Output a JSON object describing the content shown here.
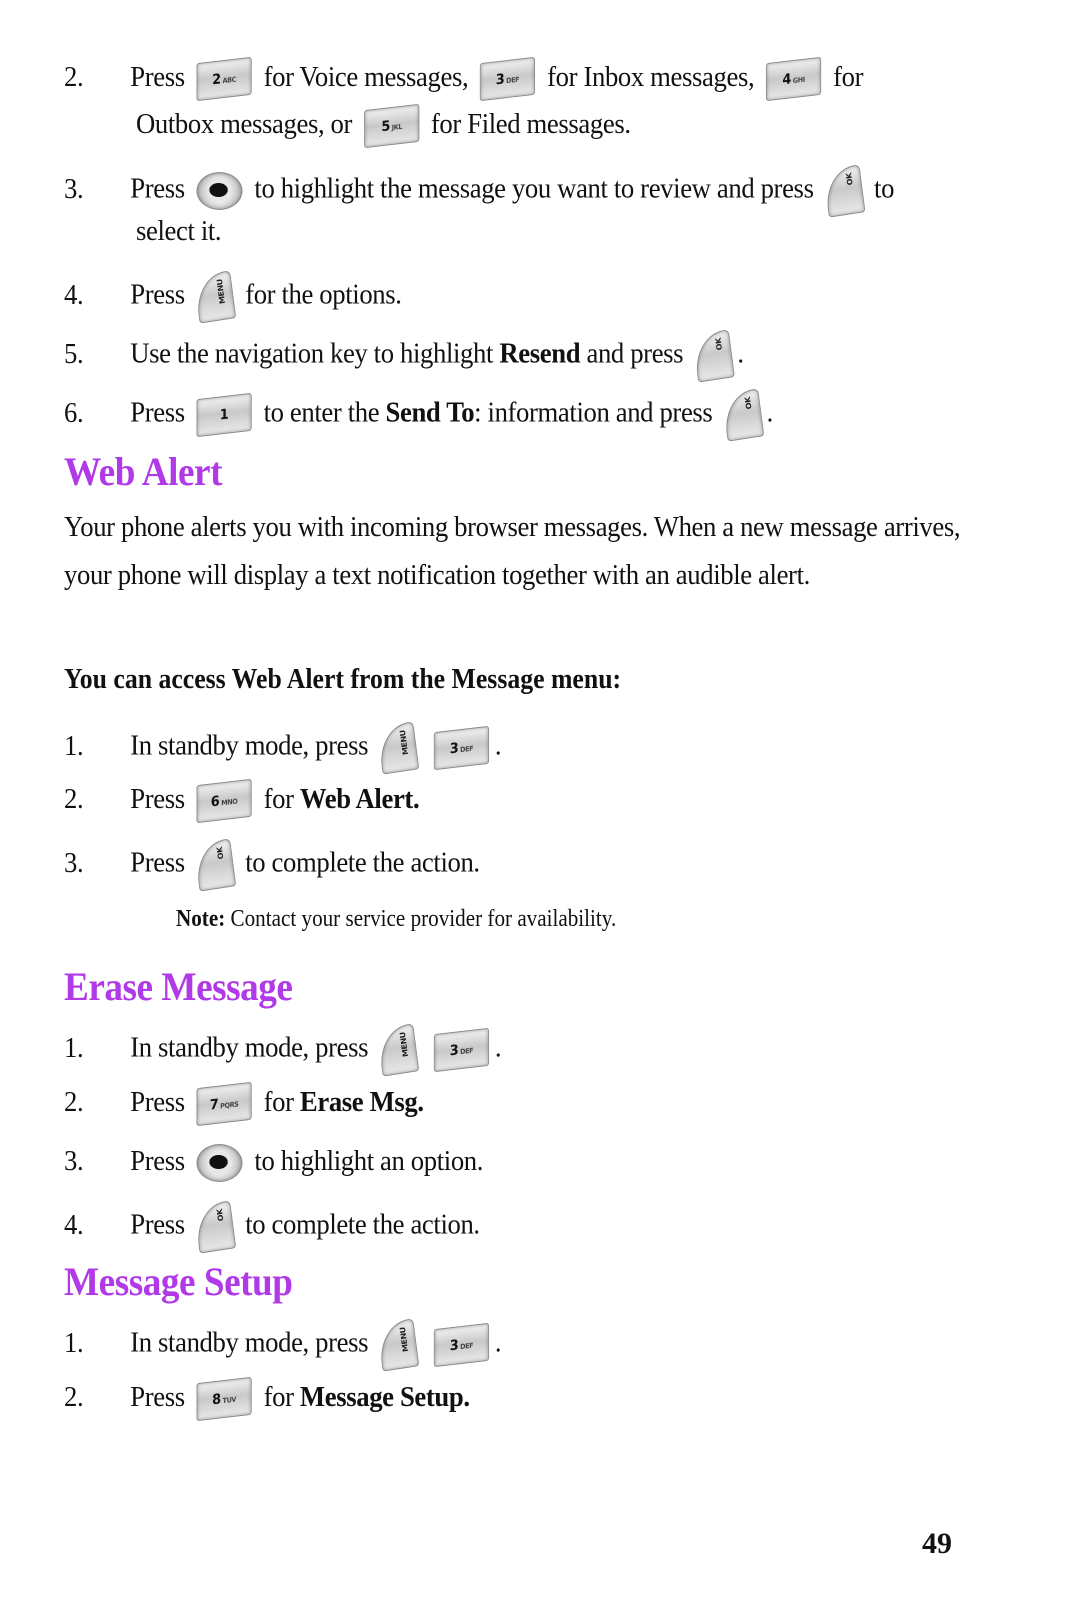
{
  "top_steps": [
    {
      "num": "2.",
      "pre": "Press",
      "k1": "2",
      "k1s": "ABC",
      "t1": "for Voice messages,",
      "k2": "3",
      "k2s": "DEF",
      "t2": "for Inbox messages,",
      "k3": "4",
      "k3s": "GHI",
      "t3": "for"
    },
    {
      "line2_pre": "Outbox messages, or",
      "k": "5",
      "ks": "JKL",
      "post": "for Filed messages."
    },
    {
      "num": "3.",
      "pre": "Press",
      "post": "to highlight the message you want to review and press",
      "end": "to"
    },
    {
      "line2": "select it."
    },
    {
      "num": "4.",
      "pre": "Press",
      "post": "for the options."
    },
    {
      "num": "5.",
      "pre": "Use the navigation key to highlight",
      "bold": "Resend",
      "post": "and press",
      "end": "."
    },
    {
      "num": "6.",
      "pre": "Press",
      "k": "1",
      "post1": "to enter the",
      "bold": "Send To",
      "post2": ": information and press",
      "end": "."
    }
  ],
  "web_alert": {
    "title": "Web Alert",
    "paragraph": "Your phone alerts you with incoming browser messages. When a new message arrives, your phone will display a text notification together with an audible alert.",
    "subheading": "You can access Web Alert from the Message menu:",
    "steps": [
      {
        "num": "1.",
        "text": "In standby mode, press",
        "k": "3",
        "ks": "DEF",
        "end": "."
      },
      {
        "num": "2.",
        "text": "Press",
        "k": "6",
        "ks": "MNO",
        "post": "for",
        "bold": "Web Alert."
      },
      {
        "num": "3.",
        "text": "Press",
        "post": "to complete the action."
      }
    ],
    "note_label": "Note:",
    "note_text": "Contact your service provider for availability."
  },
  "erase_message": {
    "title": "Erase Message",
    "steps": [
      {
        "num": "1.",
        "text": "In standby mode, press",
        "k": "3",
        "ks": "DEF",
        "end": "."
      },
      {
        "num": "2.",
        "text": "Press",
        "k": "7",
        "ks": "PQRS",
        "post": "for",
        "bold": "Erase Msg."
      },
      {
        "num": "3.",
        "text": "Press",
        "post": "to highlight an option."
      },
      {
        "num": "4.",
        "text": "Press",
        "post": "to complete the action."
      }
    ]
  },
  "message_setup": {
    "title": "Message Setup",
    "steps": [
      {
        "num": "1.",
        "text": "In standby mode, press",
        "k": "3",
        "ks": "DEF",
        "end": "."
      },
      {
        "num": "2.",
        "text": "Press",
        "k": "8",
        "ks": "TUV",
        "post": "for",
        "bold": "Message Setup."
      }
    ]
  },
  "soft_key_labels": {
    "menu": "MENU",
    "ok": "OK"
  },
  "page_number": "49",
  "colors": {
    "heading": "#b13ae8"
  }
}
